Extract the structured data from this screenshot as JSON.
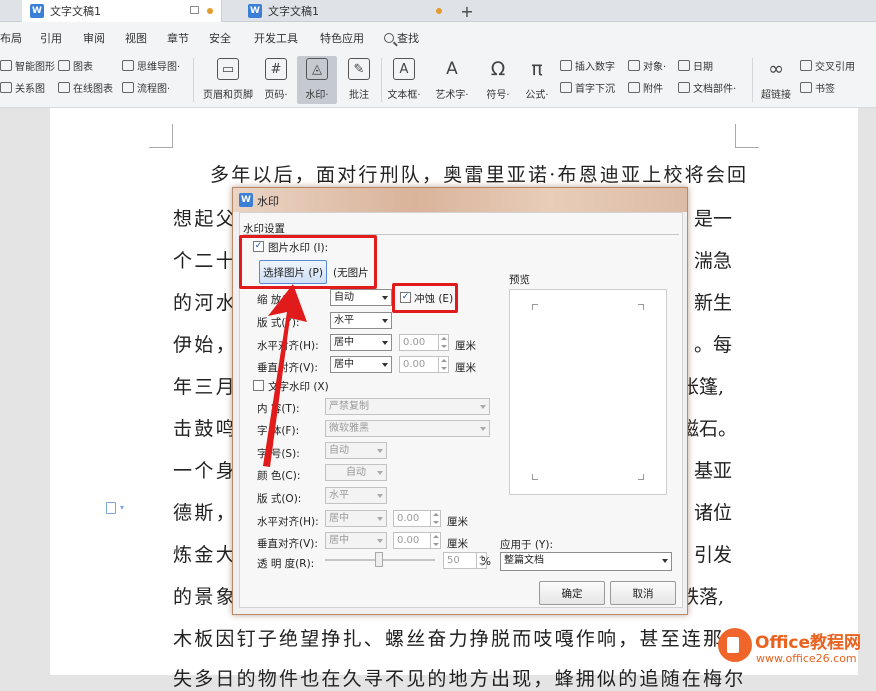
{
  "tabs": [
    {
      "label": "文字文稿1",
      "active": true
    },
    {
      "label": "文字文稿1",
      "active": false
    }
  ],
  "menu": [
    "布局",
    "引用",
    "审阅",
    "视图",
    "章节",
    "安全",
    "开发工具",
    "特色应用",
    "查找"
  ],
  "ribbon": {
    "small_left": [
      {
        "label": "智能图形",
        "icon": "smart-graphic-icon"
      },
      {
        "label": "图表",
        "icon": "chart-icon"
      },
      {
        "label": "思维导图·",
        "icon": "mindmap-icon"
      },
      {
        "label": "关系图",
        "icon": "relation-icon"
      },
      {
        "label": "在线图表",
        "icon": "online-chart-icon"
      },
      {
        "label": "流程图·",
        "icon": "flowchart-icon"
      }
    ],
    "big": [
      {
        "label": "页眉和页脚",
        "icon": "header-footer-icon",
        "glyph": "▭"
      },
      {
        "label": "页码·",
        "icon": "page-number-icon",
        "glyph": "#"
      },
      {
        "label": "水印·",
        "icon": "watermark-icon",
        "glyph": "◬",
        "selected": true
      },
      {
        "label": "批注",
        "icon": "comment-icon",
        "glyph": "✎"
      },
      {
        "label": "文本框·",
        "icon": "textbox-icon",
        "glyph": "A"
      },
      {
        "label": "艺术字·",
        "icon": "wordart-icon",
        "glyph": "A"
      },
      {
        "label": "符号·",
        "icon": "symbol-icon",
        "glyph": "Ω"
      },
      {
        "label": "公式·",
        "icon": "formula-icon",
        "glyph": "π"
      },
      {
        "label": "超链接",
        "icon": "hyperlink-icon",
        "glyph": "∞"
      }
    ],
    "small_right": [
      {
        "label": "插入数字",
        "icon": "insert-number-icon"
      },
      {
        "label": "对象·",
        "icon": "object-icon"
      },
      {
        "label": "日期",
        "icon": "date-icon"
      },
      {
        "label": "交叉引用",
        "icon": "cross-ref-icon"
      },
      {
        "label": "首字下沉",
        "icon": "drop-cap-icon"
      },
      {
        "label": "附件",
        "icon": "attachment-icon"
      },
      {
        "label": "文档部件·",
        "icon": "doc-parts-icon"
      },
      {
        "label": "书签",
        "icon": "bookmark-icon"
      }
    ]
  },
  "document": {
    "first_line": "多年以后，面对行刑队，奥雷里亚诺·布恩迪亚上校将会回",
    "left_frags": [
      "想起父",
      "个二十",
      "的河水",
      "伊始，",
      "年三月",
      "击鼓鸣",
      "一个身",
      "德斯，",
      "炼金大",
      "的景象"
    ],
    "right_frags": [
      "是一",
      "湍急",
      "新生",
      "。每",
      "帐篷,",
      "磁石。",
      "基亚",
      "诸位",
      "引发",
      "铁落,"
    ],
    "last_line": "木板因钉子绝望挣扎、螺丝奋力挣脱而吱嘎作响，甚至连那些",
    "bottom_line": "失多日的物件也在久寻不见的地方出现，蜂拥似的追随在梅尔"
  },
  "dialog": {
    "title": "水印",
    "section": "水印设置",
    "picture_watermark": {
      "label": "图片水印 (I):",
      "checked": true
    },
    "select_picture_button": "选择图片 (P)",
    "no_picture": "(无图片",
    "scale": {
      "label": "缩    放(L):",
      "value": "自动"
    },
    "washout": {
      "label": "冲蚀 (E)",
      "checked": true
    },
    "layout": {
      "label": "版    式(Y):",
      "value": "水平"
    },
    "h_align": {
      "label": "水平对齐(H):",
      "value": "居中",
      "offset": "0.00",
      "unit": "厘米"
    },
    "v_align": {
      "label": "垂直对齐(V):",
      "value": "居中",
      "offset": "0.00",
      "unit": "厘米"
    },
    "text_watermark": {
      "label": "文字水印 (X)",
      "checked": false
    },
    "content": {
      "label": "内    容(T):",
      "value": "严禁复制"
    },
    "font": {
      "label": "字    体(F):",
      "value": "微软雅黑"
    },
    "size": {
      "label": "字    号(S):",
      "value": "自动"
    },
    "color": {
      "label": "颜    色(C):",
      "value": "自动"
    },
    "text_layout": {
      "label": "版    式(O):",
      "value": "水平"
    },
    "text_h_align": {
      "label": "水平对齐(H):",
      "value": "居中",
      "offset": "0.00",
      "unit": "厘米"
    },
    "text_v_align": {
      "label": "垂直对齐(V):",
      "value": "居中",
      "offset": "0.00",
      "unit": "厘米"
    },
    "transparency": {
      "label": "透 明 度(R):",
      "value": "50",
      "unit": "%"
    },
    "preview_label": "预览",
    "apply_to": {
      "label": "应用于 (Y):",
      "value": "整篇文档"
    },
    "ok": "确定",
    "cancel": "取消"
  },
  "logo": {
    "text": "Office教程网",
    "url": "www.office26.com"
  },
  "colors": {
    "highlight": "#e11b1b",
    "accent": "#3b7fd6",
    "logo": "#e9621f"
  }
}
